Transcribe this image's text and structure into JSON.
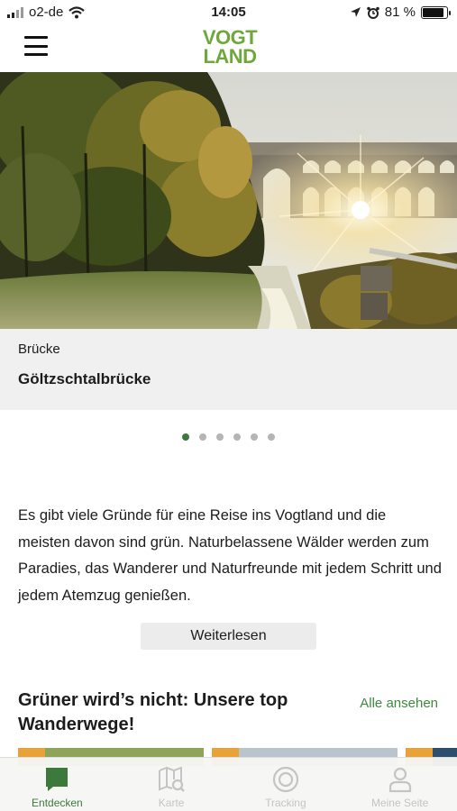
{
  "status_bar": {
    "carrier": "o2-de",
    "time": "14:05",
    "battery": "81 %",
    "battery_level": 0.81
  },
  "header": {
    "logo_line1": "VOGT",
    "logo_line2": "LAND"
  },
  "hero": {
    "category": "Brücke",
    "title": "Göltzschtalbrücke",
    "slide_count": 6,
    "active_slide": 1
  },
  "intro": {
    "text": "Es gibt viele Gründe für eine Reise ins Vogtland und die meisten davon sind grün. Naturbelassene Wälder werden zum Paradies, das Wanderer und Naturfreunde mit jedem Schritt und jedem Atemzug genießen.",
    "read_more": "Weiterlesen"
  },
  "section": {
    "title": "Grüner wird’s nicht: Unsere top Wanderwege!",
    "see_all": "Alle ansehen"
  },
  "tabs": [
    {
      "label": "Entdecken",
      "icon": "chat-bubble-icon",
      "active": true
    },
    {
      "label": "Karte",
      "icon": "map-search-icon",
      "active": false
    },
    {
      "label": "Tracking",
      "icon": "target-icon",
      "active": false
    },
    {
      "label": "Meine Seite",
      "icon": "user-icon",
      "active": false
    }
  ],
  "colors": {
    "brand_green": "#3c7a3c",
    "logo_green": "#6ea83a",
    "accent_orange": "#e8a23a"
  }
}
